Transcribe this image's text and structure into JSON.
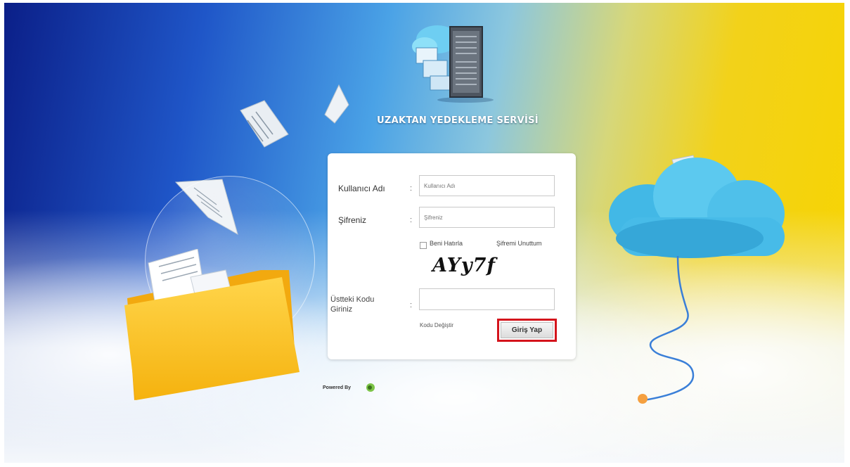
{
  "header": {
    "brand_title": "UZAKTAN YEDEKLEME SERVİSİ"
  },
  "login": {
    "username_label": "Kullanıcı Adı",
    "username_placeholder": "Kullanıcı Adı",
    "password_label": "Şifreniz",
    "password_placeholder": "Şifreniz",
    "colon": ":",
    "remember_label": "Beni Hatırla",
    "forgot_label": "Şifremi Unuttum",
    "captcha_text": "AYy7f",
    "code_label": "Üstteki Kodu Giriniz",
    "code_value": "",
    "change_code_label": "Kodu Değiştir",
    "submit_label": "Giriş Yap"
  },
  "footer": {
    "powered_by_label": "Powered By"
  },
  "colors": {
    "highlight_border": "#d4141c",
    "sky_blue": "#1f56c8",
    "sun_yellow": "#f7d400"
  }
}
